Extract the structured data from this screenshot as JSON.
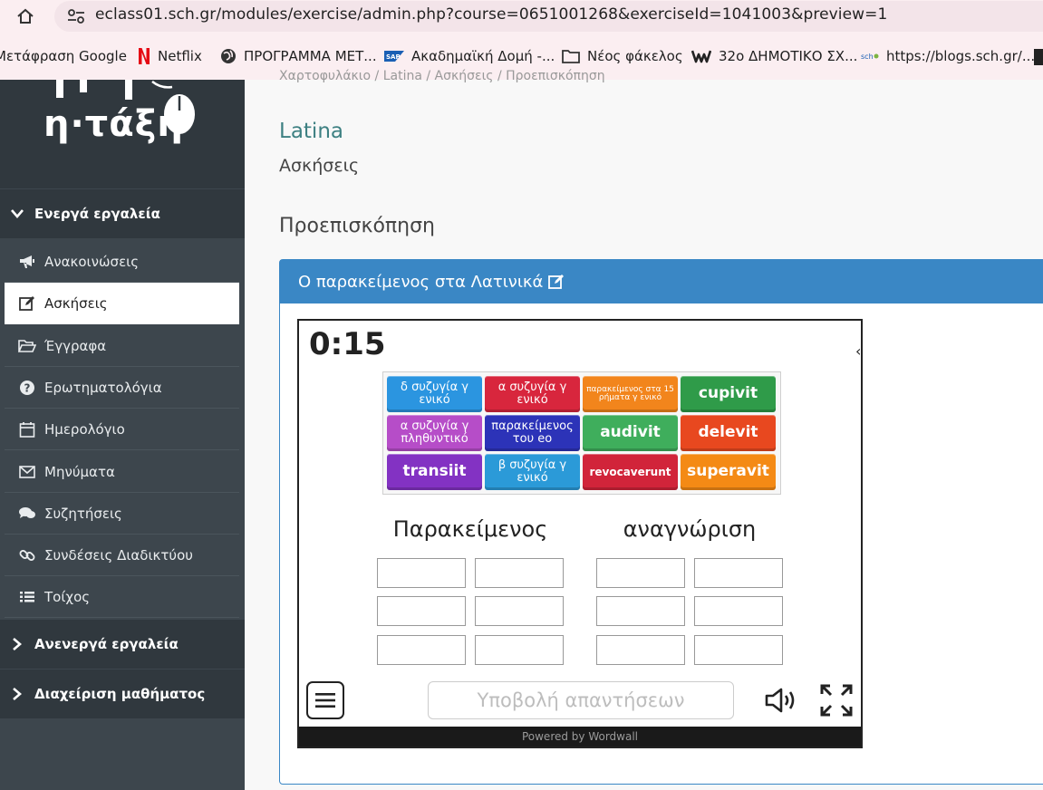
{
  "browser": {
    "url": "eclass01.sch.gr/modules/exercise/admin.php?course=0651001268&exerciseId=1041003&preview=1",
    "bookmarks": [
      {
        "label": "Μετάφραση Google",
        "icon": "translate-icon"
      },
      {
        "label": "Netflix",
        "icon": "netflix-icon"
      },
      {
        "label": "ΠΡΟΓΡΑΜΜΑ ΜΕΤ...",
        "icon": "globe-icon"
      },
      {
        "label": "Ακαδημαϊκή Δομή -...",
        "icon": "sap-icon"
      },
      {
        "label": "Νέος φάκελος",
        "icon": "folder-icon"
      },
      {
        "label": "32ο ΔΗΜΟΤΙΚΟ ΣΧ...",
        "icon": "weebly-icon"
      },
      {
        "label": "https://blogs.sch.gr/...",
        "icon": "sch-icon"
      }
    ]
  },
  "sidebar": {
    "logo": "η·τάξη",
    "active_tools_header": "Ενεργά εργαλεία",
    "items": [
      {
        "label": "Ανακοινώσεις",
        "icon": "megaphone-icon"
      },
      {
        "label": "Ασκήσεις",
        "icon": "edit-icon"
      },
      {
        "label": "Έγγραφα",
        "icon": "folder-open-icon"
      },
      {
        "label": "Ερωτηματολόγια",
        "icon": "question-icon"
      },
      {
        "label": "Ημερολόγιο",
        "icon": "calendar-icon"
      },
      {
        "label": "Μηνύματα",
        "icon": "envelope-icon"
      },
      {
        "label": "Συζητήσεις",
        "icon": "comments-icon"
      },
      {
        "label": "Συνδέσεις Διαδικτύου",
        "icon": "link-icon"
      },
      {
        "label": "Τοίχος",
        "icon": "list-icon"
      }
    ],
    "inactive_tools_header": "Ανενεργά εργαλεία",
    "course_admin_header": "Διαχείριση μαθήματος"
  },
  "main": {
    "breadcrumb": "Χαρτοφυλάκιο  /  Latina  /  Ασκήσεις  /  Προεπισκόπηση",
    "course_title": "Latina",
    "section_title": "Ασκήσεις",
    "page_heading": "Προεπισκόπηση",
    "panel_title": "Ο παρακείμενος στα Λατινικά"
  },
  "game": {
    "timer": "0:15",
    "side_mark": "‹",
    "tiles": [
      {
        "text": "δ συζυγία γ ενικό",
        "color": "#2b95e0",
        "size": "small"
      },
      {
        "text": "α συζυγία γ ενικό",
        "color": "#d8263d",
        "size": "small"
      },
      {
        "text": "παρακείμενος στα 15 ρήματα γ ενικό",
        "color": "#f2851c",
        "size": "tiny"
      },
      {
        "text": "cupivit",
        "color": "#2f9b49",
        "size": "big"
      },
      {
        "text": "α συζυγία γ πληθυντικό",
        "color": "#b64dc8",
        "size": "small"
      },
      {
        "text": "παρακείμενος του eo",
        "color": "#2c33b8",
        "size": "small"
      },
      {
        "text": "audivit",
        "color": "#3fae5c",
        "size": "big"
      },
      {
        "text": "delevit",
        "color": "#e8481f",
        "size": "big"
      },
      {
        "text": "transiit",
        "color": "#8332c3",
        "size": "big"
      },
      {
        "text": "β συζυγία γ ενικό",
        "color": "#2b9ad8",
        "size": "small"
      },
      {
        "text": "revocaverunt",
        "color": "#d1243a",
        "size": "mid"
      },
      {
        "text": "superavit",
        "color": "#f48a15",
        "size": "big"
      }
    ],
    "column_1_title": "Παρακείμενος",
    "column_2_title": "αναγνώριση",
    "submit_label": "Υποβολή απαντήσεων",
    "powered_by": "Powered by Wordwall"
  }
}
